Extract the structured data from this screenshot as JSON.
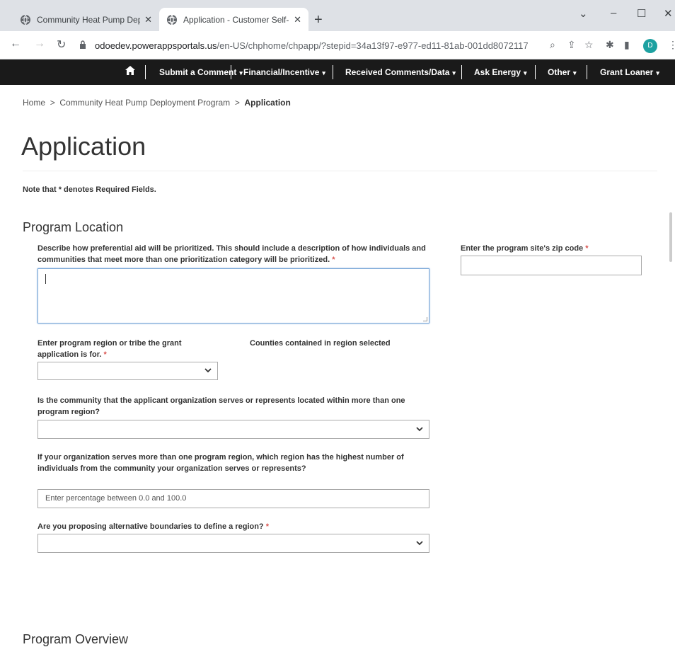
{
  "browser": {
    "tabs": [
      {
        "title": "Community Heat Pump Deploym",
        "active": false
      },
      {
        "title": "Application - Customer Self-Servi",
        "active": true
      }
    ],
    "new_tab": "+",
    "url_host": "odoedev.powerappsportals.us",
    "url_path": "/en-US/chphome/chpapp/?stepid=34a13f97-e977-ed11-81ab-001dd8072117",
    "profile_initial": "D",
    "profile_color": "#1da1a1"
  },
  "sitenav": {
    "items": [
      {
        "label": "Submit a Comment",
        "dropdown": true
      },
      {
        "label": "Financial/Incentive",
        "dropdown": true
      },
      {
        "label": "Received Comments/Data",
        "dropdown": true
      },
      {
        "label": "Ask Energy",
        "dropdown": true
      },
      {
        "label": "Other",
        "dropdown": true
      },
      {
        "label": "Grant Loaner",
        "dropdown": true
      }
    ]
  },
  "breadcrumb": {
    "home": "Home",
    "sep1": ">",
    "parent": "Community Heat Pump Deployment Program",
    "sep2": ">",
    "current": "Application"
  },
  "page": {
    "title": "Application",
    "note": "Note that * denotes Required Fields."
  },
  "sections": {
    "program_location": "Program Location",
    "program_overview": "Program Overview"
  },
  "fields": {
    "preferential_aid": {
      "label": "Describe how preferential aid will be prioritized. This should include a description of how individuals and communities that meet more than one prioritization category will be prioritized.",
      "required_mark": "*",
      "value": ""
    },
    "zip_code": {
      "label": "Enter the program site's zip code",
      "required_mark": "*",
      "value": ""
    },
    "region": {
      "label": "Enter program region or tribe the grant application is for.",
      "required_mark": "*",
      "value": ""
    },
    "counties": {
      "label": "Counties contained in region selected"
    },
    "multi_region": {
      "label": "Is the community that the applicant organization serves or represents located within more than one program region?",
      "value": ""
    },
    "highest_region": {
      "label": "If your organization serves more than one program region, which region has the highest number of individuals from the community your organization serves or represents?",
      "placeholder": "Enter percentage between 0.0 and 100.0"
    },
    "alt_boundaries": {
      "label": "Are you proposing alternative boundaries to define a region?",
      "required_mark": "*",
      "value": ""
    }
  }
}
